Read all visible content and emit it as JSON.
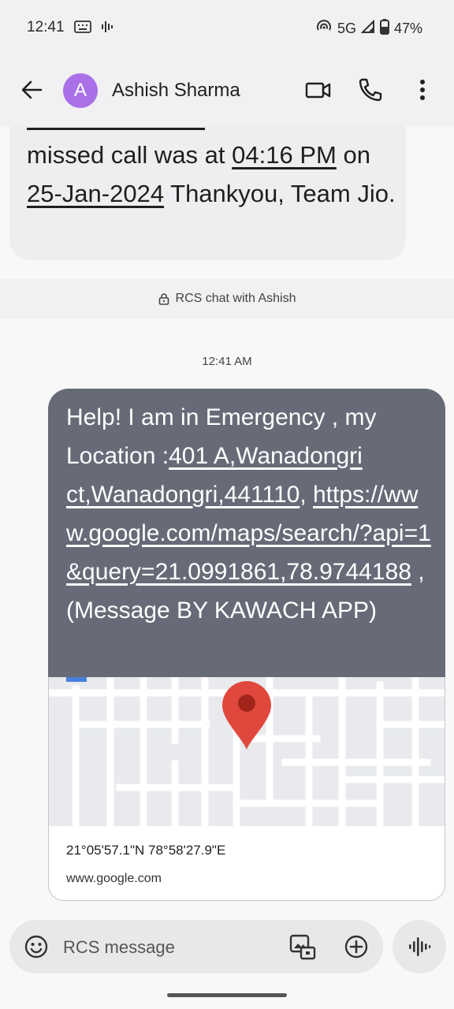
{
  "status_bar": {
    "time": "12:41",
    "network": "5G",
    "battery": "47%"
  },
  "header": {
    "avatar_letter": "A",
    "contact_name": "Ashish Sharma"
  },
  "previous_message": {
    "text_part1": "missed call was at ",
    "time": "04:16 PM",
    "text_part2": " on ",
    "date": "25-Jan-2024",
    "text_part3": " Thankyou, Team Jio."
  },
  "rcs_banner": "RCS chat with Ashish",
  "timestamp": "12:41 AM",
  "sent_message": {
    "text_part1": "Help! I am in Emergency , my Location :",
    "address": "401 A,Wanadongri ct,Wanadongri,441110",
    "text_part2": ", ",
    "url": "https://www.google.com/maps/search/?api=1&query=21.0991861,78.9744188",
    "text_part3": " , (Message BY KAWACH APP)"
  },
  "map_preview": {
    "coordinates": "21°05'57.1\"N 78°58'27.9\"E",
    "site": "www.google.com"
  },
  "composer": {
    "placeholder": "RCS message"
  },
  "colors": {
    "sent_bubble": "#676b78",
    "avatar": "#a970e8",
    "map_pin": "#e0483d"
  }
}
